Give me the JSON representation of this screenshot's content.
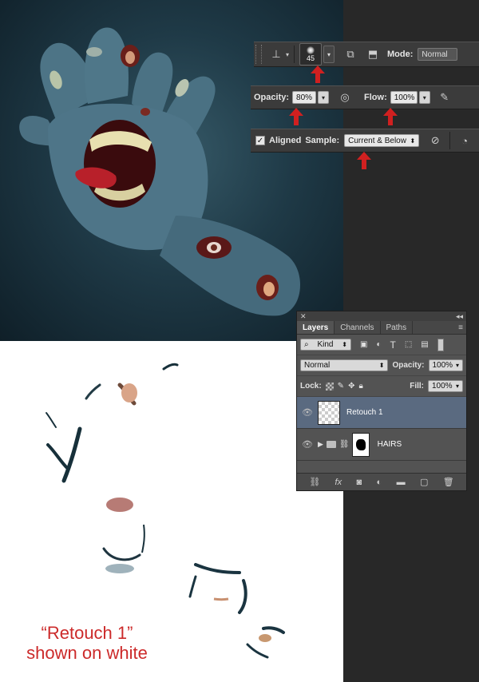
{
  "toolbar_brush": {
    "brush_size": "45",
    "mode_label": "Mode:",
    "mode_value": "Normal"
  },
  "toolbar_opacity": {
    "opacity_label": "Opacity:",
    "opacity_value": "80%",
    "flow_label": "Flow:",
    "flow_value": "100%"
  },
  "toolbar_sample": {
    "aligned_label": "Aligned",
    "aligned_checked": true,
    "sample_label": "Sample:",
    "sample_value": "Current & Below"
  },
  "layers_panel": {
    "tabs": [
      {
        "label": "Layers",
        "active": true
      },
      {
        "label": "Channels",
        "active": false
      },
      {
        "label": "Paths",
        "active": false
      }
    ],
    "filter_kind": "Kind",
    "blend_mode": "Normal",
    "opacity_label": "Opacity:",
    "opacity_value": "100%",
    "lock_label": "Lock:",
    "fill_label": "Fill:",
    "fill_value": "100%",
    "layers": [
      {
        "name": "Retouch 1",
        "selected": true
      },
      {
        "name": "HAIRS",
        "selected": false
      }
    ]
  },
  "caption": {
    "line1": "“Retouch 1”",
    "line2": "shown on white"
  },
  "colors": {
    "accent_red": "#cc2a2a",
    "panel_bg": "#535353",
    "selected_layer": "#5a6a80"
  }
}
